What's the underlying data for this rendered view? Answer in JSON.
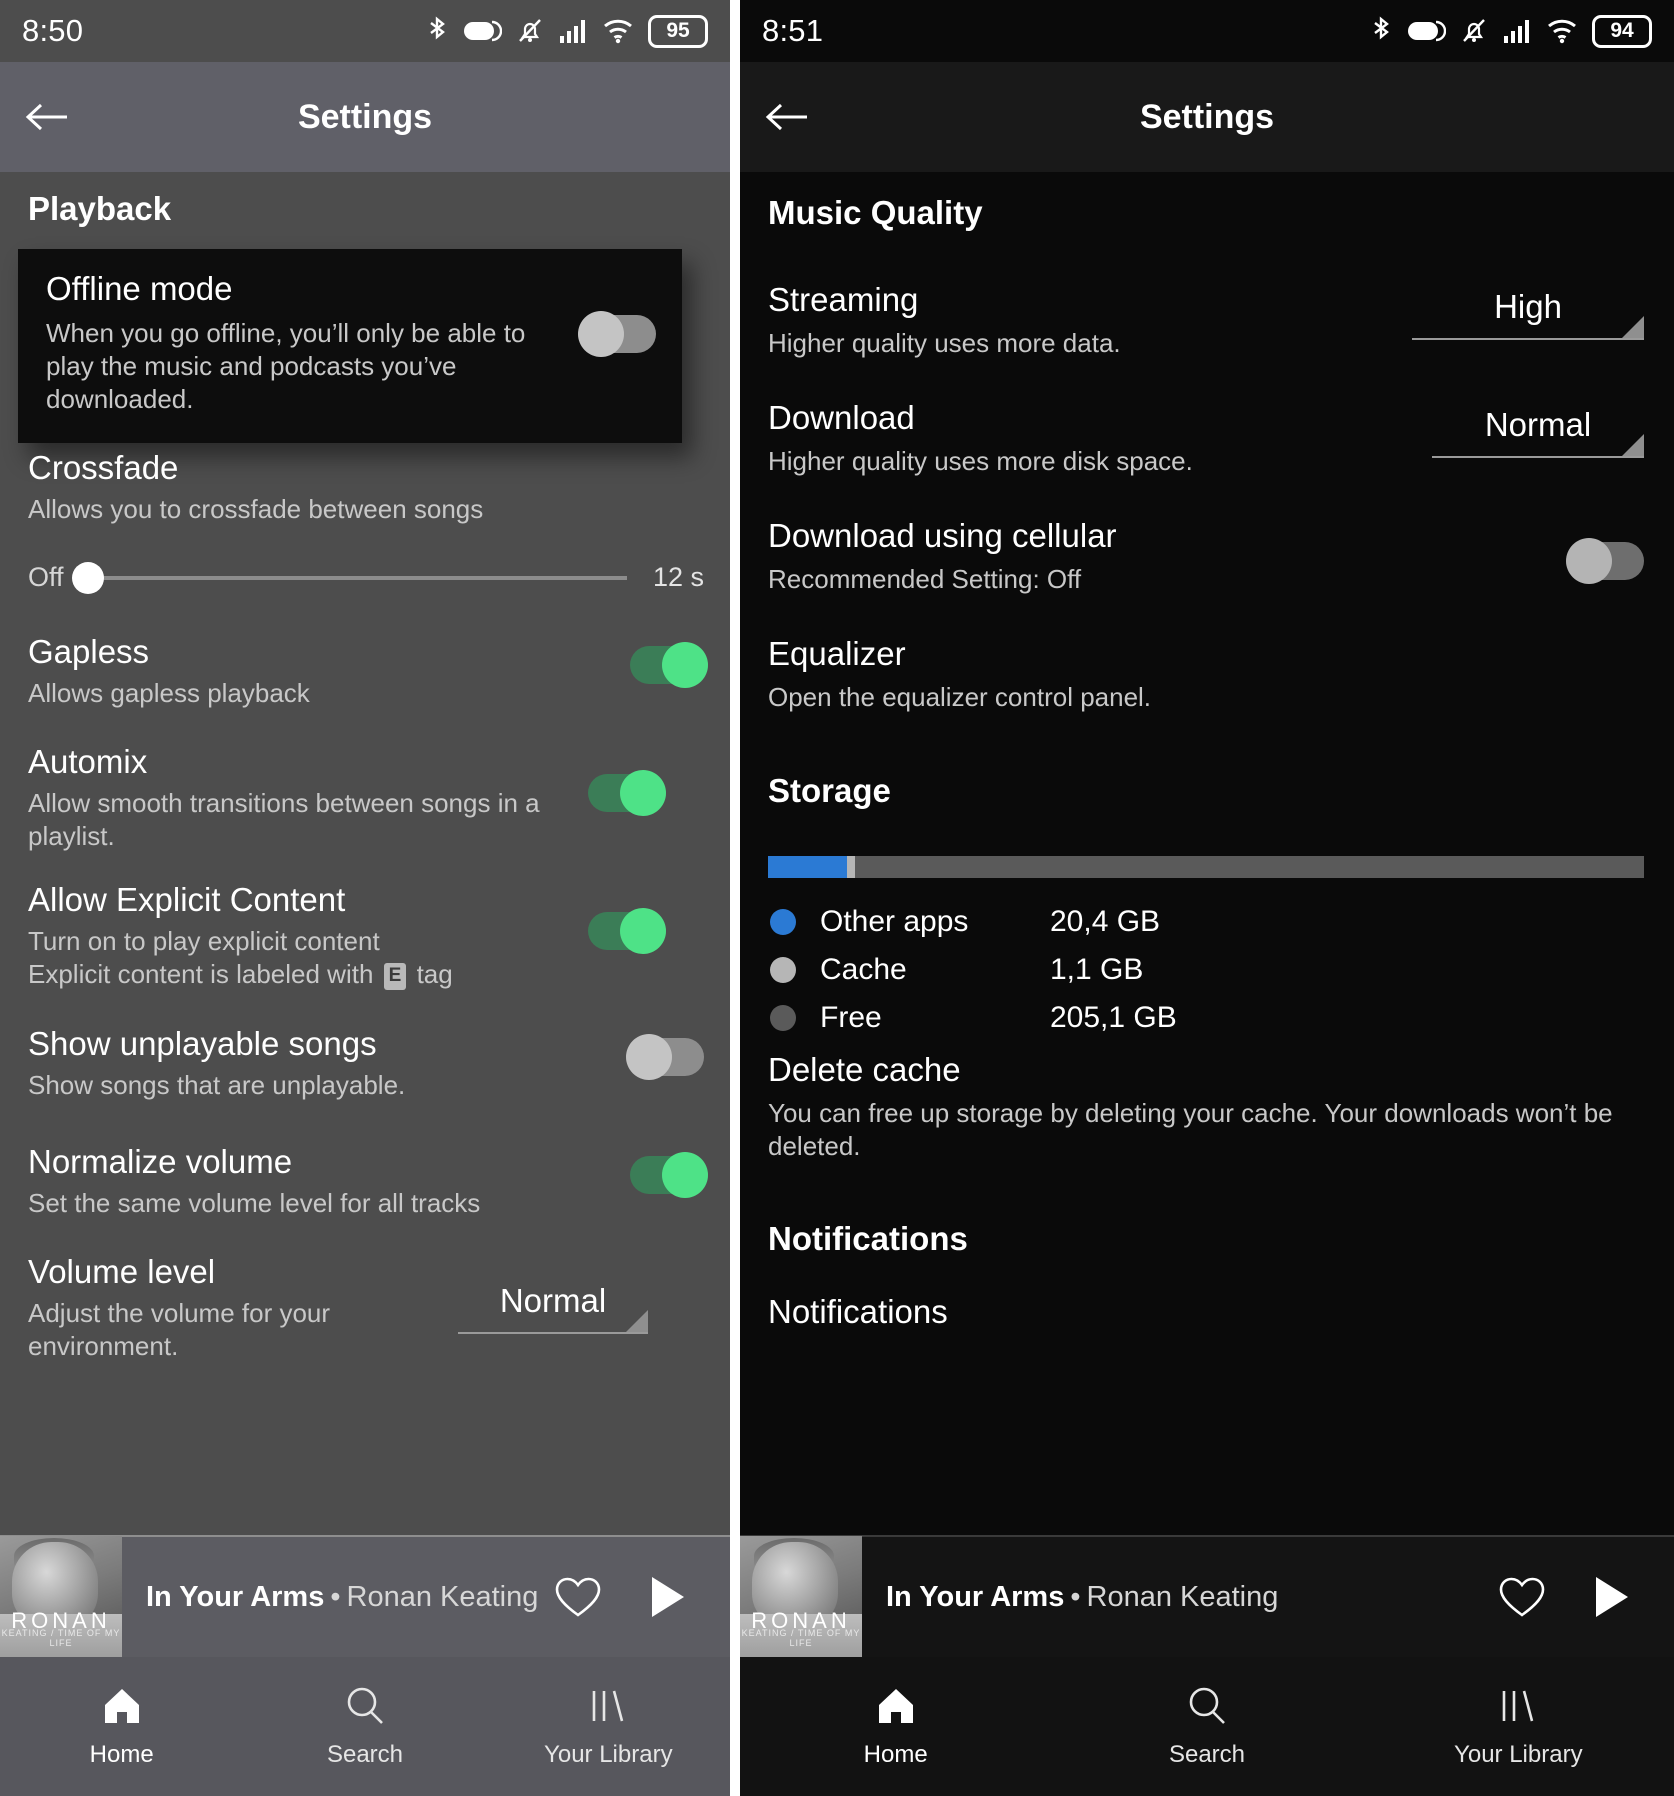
{
  "left": {
    "status": {
      "time": "8:50",
      "battery": "95"
    },
    "appbar": {
      "title": "Settings",
      "back_icon": "arrow-left-icon"
    },
    "section": {
      "playback": "Playback"
    },
    "offline": {
      "title": "Offline mode",
      "desc": "When you go offline, you’ll only be able to play the music and podcasts you’ve downloaded.",
      "toggle_state": "off"
    },
    "crossfade": {
      "title": "Crossfade",
      "desc": "Allows you to crossfade between songs",
      "min_label": "Off",
      "max_label": "12 s",
      "value_percent": 0
    },
    "gapless": {
      "title": "Gapless",
      "desc": "Allows gapless playback",
      "toggle_state": "on"
    },
    "automix": {
      "title": "Automix",
      "desc": "Allow smooth transitions between songs in a playlist.",
      "toggle_state": "on"
    },
    "explicit": {
      "title": "Allow Explicit Content",
      "desc_line1": "Turn on to play explicit content",
      "desc_line2a": "Explicit content is labeled with",
      "desc_badge": "E",
      "desc_line2b": "tag",
      "toggle_state": "on"
    },
    "unplayable": {
      "title": "Show unplayable songs",
      "desc": "Show songs that are unplayable.",
      "toggle_state": "off"
    },
    "normalize": {
      "title": "Normalize volume",
      "desc": "Set the same volume level for all tracks",
      "toggle_state": "on"
    },
    "volume_level": {
      "title": "Volume level",
      "desc": "Adjust the volume for your environment.",
      "value": "Normal"
    }
  },
  "right": {
    "status": {
      "time": "8:51",
      "battery": "94"
    },
    "appbar": {
      "title": "Settings",
      "back_icon": "arrow-left-icon"
    },
    "section": {
      "music_quality": "Music Quality",
      "storage": "Storage",
      "notifications": "Notifications"
    },
    "streaming": {
      "title": "Streaming",
      "desc": "Higher quality uses more data.",
      "value": "High"
    },
    "download": {
      "title": "Download",
      "desc": "Higher quality uses more disk space.",
      "value": "Normal"
    },
    "cellular": {
      "title": "Download using cellular",
      "desc": "Recommended Setting: Off",
      "toggle_state": "off"
    },
    "equalizer": {
      "title": "Equalizer",
      "desc": "Open the equalizer control panel."
    },
    "delete_cache": {
      "title": "Delete cache",
      "desc": "You can free up storage by deleting your cache. Your downloads won’t be deleted."
    },
    "notifications_item": {
      "title": "Notifications"
    },
    "storage_chart": {
      "type": "bar",
      "title": "Storage",
      "unit": "GB",
      "categories": [
        "Other apps",
        "Cache",
        "Free"
      ],
      "values": [
        20.4,
        1.1,
        205.1
      ],
      "value_labels": [
        "20,4 GB",
        "1,1 GB",
        "205,1 GB"
      ],
      "colors": [
        "#2b7ad4",
        "#b6b6b6",
        "#5a5a5a"
      ],
      "total": 226.6,
      "percents": [
        9.0,
        0.5,
        90.5
      ],
      "legend": "vertical-left"
    }
  },
  "nowplaying": {
    "title": "In Your Arms",
    "separator": "•",
    "artist": "Ronan Keating",
    "album_art_text": "RONAN",
    "album_art_subtext": "KEATING / TIME OF MY LIFE",
    "like_icon": "heart-outline-icon",
    "play_icon": "play-icon"
  },
  "bottomnav": {
    "items": [
      {
        "label": "Home",
        "icon": "home-icon",
        "active": true
      },
      {
        "label": "Search",
        "icon": "search-icon",
        "active": false
      },
      {
        "label": "Your Library",
        "icon": "library-icon",
        "active": false
      }
    ]
  },
  "colors": {
    "accent_green": "#4ee287",
    "accent_blue": "#2b7ad4",
    "cache_gray": "#b6b6b6",
    "free_gray": "#5a5a5a"
  }
}
